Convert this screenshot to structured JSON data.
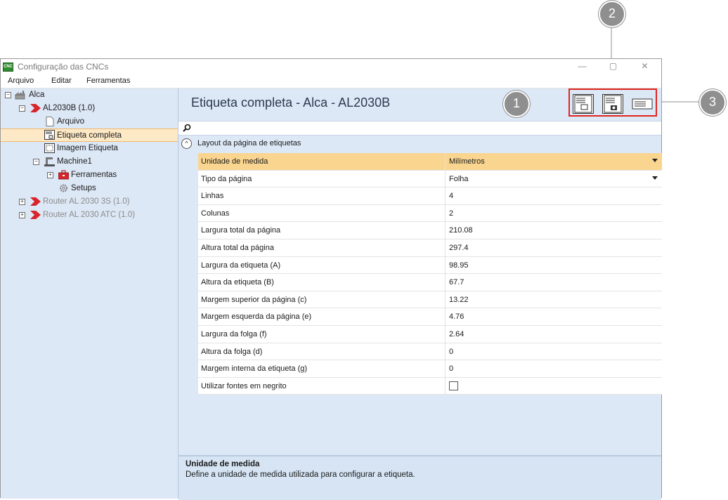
{
  "window": {
    "title": "Configuração das CNCs",
    "app_icon_text": "CNC",
    "minimize": "—",
    "maximize": "▢",
    "close": "✕"
  },
  "menu": [
    "Arquivo",
    "Editar",
    "Ferramentas"
  ],
  "tree": {
    "root": "Alca",
    "machine": "AL2030B (1.0)",
    "arquivo": "Arquivo",
    "etiqueta_completa": "Etiqueta completa",
    "imagem_etiqueta": "Imagem Etiqueta",
    "machine1": "Machine1",
    "ferramentas": "Ferramentas",
    "setups": "Setups",
    "router1": "Router AL 2030 3S (1.0)",
    "router2": "Router AL 2030 ATC (1.0)"
  },
  "main": {
    "title": "Etiqueta completa - Alca - AL2030B",
    "section": "Layout da página de etiquetas",
    "rows": [
      {
        "name": "Unidade de medida",
        "value": "Milímetros"
      },
      {
        "name": "Tipo da página",
        "value": "Folha"
      },
      {
        "name": "Linhas",
        "value": "4"
      },
      {
        "name": "Colunas",
        "value": "2"
      },
      {
        "name": "Largura total da página",
        "value": "210.08"
      },
      {
        "name": "Altura total da página",
        "value": "297.4"
      },
      {
        "name": "Largura da etiqueta (A)",
        "value": "98.95"
      },
      {
        "name": "Altura da etiqueta (B)",
        "value": "67.7"
      },
      {
        "name": "Margem superior da página (c)",
        "value": "13.22"
      },
      {
        "name": "Margem esquerda da página (e)",
        "value": "4.76"
      },
      {
        "name": "Largura da folga (f)",
        "value": "2.64"
      },
      {
        "name": "Altura da folga (d)",
        "value": "0"
      },
      {
        "name": "Margem interna da etiqueta (g)",
        "value": "0"
      },
      {
        "name": "Utilizar fontes em negrito",
        "value": ""
      }
    ],
    "description_title": "Unidade de medida",
    "description_text": "Define a unidade de medida utilizada para configurar a etiqueta."
  },
  "callouts": [
    "1",
    "2",
    "3"
  ],
  "colors": {
    "highlight_box": "#e0241f",
    "selected_row": "#f9d58f",
    "machine_arrow": "#d8252b",
    "panel_bg": "#dde8f6"
  }
}
